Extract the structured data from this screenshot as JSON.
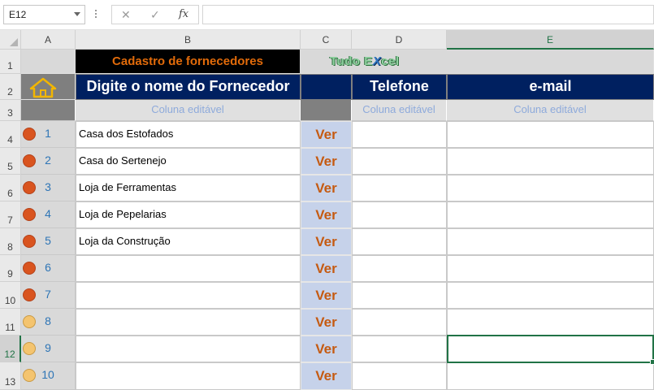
{
  "formula_bar": {
    "name_box": "E12",
    "cancel_icon": "✕",
    "enter_icon": "✓",
    "fx_label": "fx",
    "formula": ""
  },
  "columns": [
    "A",
    "B",
    "C",
    "D",
    "E"
  ],
  "selected_column": "E",
  "selected_row": "12",
  "rows": [
    "1",
    "2",
    "3",
    "4",
    "5",
    "6",
    "7",
    "8",
    "9",
    "10",
    "11",
    "12",
    "13"
  ],
  "sheet": {
    "title": "Cadastro de fornecedores",
    "logo_pre": "Tudo E",
    "logo_x": "X",
    "logo_post": "cel",
    "headers": {
      "name": "Digite o nome do Fornecedor",
      "phone": "Telefone",
      "email": "e-mail"
    },
    "editable_note": "Coluna editável",
    "home_icon": "home-icon",
    "ver_label": "Ver",
    "records": [
      {
        "num": "1",
        "status": "red",
        "name": "Casa dos Estofados"
      },
      {
        "num": "2",
        "status": "red",
        "name": "Casa do Sertenejo"
      },
      {
        "num": "3",
        "status": "red",
        "name": "Loja de Ferramentas"
      },
      {
        "num": "4",
        "status": "red",
        "name": "Loja de Pepelarias"
      },
      {
        "num": "5",
        "status": "red",
        "name": "Loja da Construção"
      },
      {
        "num": "6",
        "status": "red",
        "name": ""
      },
      {
        "num": "7",
        "status": "red",
        "name": ""
      },
      {
        "num": "8",
        "status": "yellow",
        "name": ""
      },
      {
        "num": "9",
        "status": "yellow",
        "name": ""
      },
      {
        "num": "10",
        "status": "yellow",
        "name": ""
      }
    ]
  },
  "colors": {
    "header_navy": "#002060",
    "title_orange": "#e26b0a",
    "ver_text": "#c55a11",
    "ver_fill": "#c6d2ea",
    "status_red": "#d9541f",
    "status_yellow": "#f4c46f",
    "excel_green": "#217346"
  }
}
